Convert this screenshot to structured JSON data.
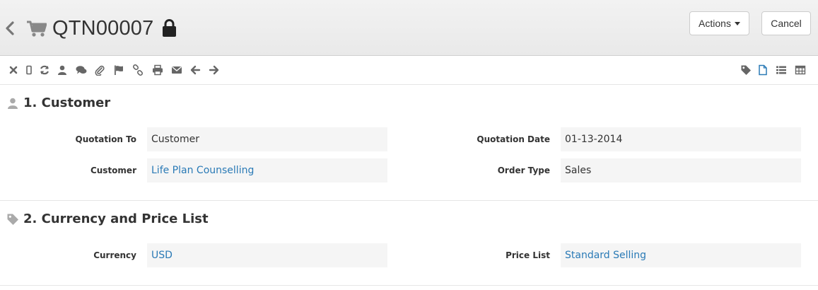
{
  "header": {
    "title": "QTN00007",
    "actions_label": "Actions",
    "cancel_label": "Cancel"
  },
  "toolbar": {
    "left_icons": [
      "close-icon",
      "mobile-icon",
      "refresh-icon",
      "user-icon",
      "comments-icon",
      "paperclip-icon",
      "flag-icon",
      "link-icon",
      "print-icon",
      "envelope-icon",
      "arrow-left-icon",
      "arrow-right-icon"
    ],
    "right_icons": [
      "tag-icon",
      "file-icon",
      "list-icon",
      "table-icon"
    ],
    "active_color": "#2a7ab6",
    "icon_color": "#666666"
  },
  "sections": [
    {
      "title": "1. Customer",
      "icon": "user-icon",
      "fields": [
        {
          "label": "Quotation To",
          "value": "Customer"
        },
        {
          "label": "Quotation Date",
          "value": "01-13-2014"
        },
        {
          "label": "Customer",
          "value": "Life Plan Counselling"
        },
        {
          "label": "Order Type",
          "value": "Sales"
        }
      ]
    },
    {
      "title": "2. Currency and Price List",
      "icon": "tag-icon",
      "fields": [
        {
          "label": "Currency",
          "value": "USD"
        },
        {
          "label": "Price List",
          "value": "Standard Selling"
        }
      ]
    }
  ],
  "colors": {
    "link": "#2a7ab6",
    "header_bg": "#ededed",
    "field_bg": "#f5f5f5"
  }
}
